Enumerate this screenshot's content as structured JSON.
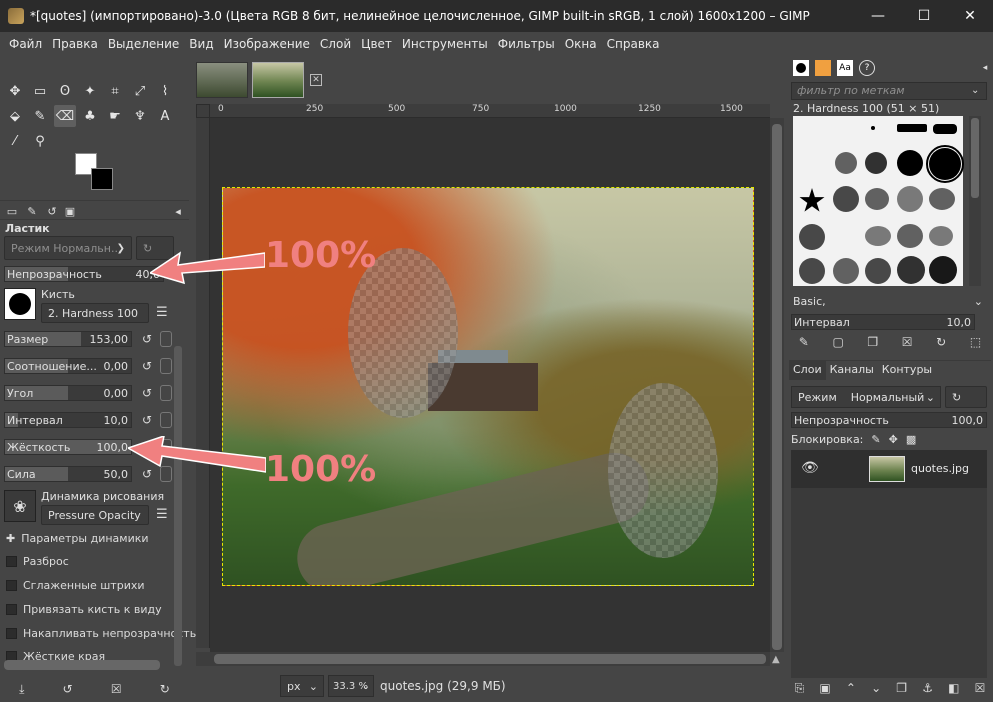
{
  "window": {
    "title": "*[quotes] (импортировано)-3.0 (Цвета RGB 8 бит, нелинейное целочисленное, GIMP built-in sRGB, 1 слой) 1600x1200 – GIMP",
    "minimize": "—",
    "maximize": "☐",
    "close": "✕"
  },
  "menu": [
    "Файл",
    "Правка",
    "Выделение",
    "Вид",
    "Изображение",
    "Слой",
    "Цвет",
    "Инструменты",
    "Фильтры",
    "Окна",
    "Справка"
  ],
  "tool_options": {
    "title": "Ластик",
    "mode_combo": "Режим Нормальн...",
    "opacity": {
      "label": "Непрозрачность",
      "value": "40,0",
      "fraction": 0.4
    },
    "brush_label": "Кисть",
    "brush_name": "2. Hardness 100",
    "size": {
      "label": "Размер",
      "value": "153,00",
      "fraction": 0.6
    },
    "ratio": {
      "label": "Соотношение...",
      "value": "0,00",
      "fraction": 0.5
    },
    "angle": {
      "label": "Угол",
      "value": "0,00",
      "fraction": 0.5
    },
    "spacing": {
      "label": "Интервал",
      "value": "10,0",
      "fraction": 0.1
    },
    "hardness": {
      "label": "Жёсткость",
      "value": "100,0",
      "fraction": 1.0
    },
    "force": {
      "label": "Сила",
      "value": "50,0",
      "fraction": 0.5
    },
    "dynamics_label": "Динамика рисования",
    "dynamics_name": "Pressure Opacity",
    "checks": [
      {
        "label": "Параметры динамики"
      },
      {
        "label": "Разброс"
      },
      {
        "label": "Сглаженные штрихи"
      },
      {
        "label": "Привязать кисть к виду"
      },
      {
        "label": "Накапливать непрозрачность"
      },
      {
        "label": "Жёсткие края"
      }
    ]
  },
  "annotations": {
    "top": "100%",
    "bottom": "100%"
  },
  "rulers": [
    "0",
    "250",
    "500",
    "750",
    "1000",
    "1250",
    "1500"
  ],
  "status": {
    "unit": "px",
    "zoom": "33.3 %",
    "file": "quotes.jpg (29,9 МБ)"
  },
  "brushes": {
    "filter_placeholder": "фильтр по меткам",
    "selected": "2. Hardness 100 (51 × 51)",
    "set": "Basic,",
    "spacing": {
      "label": "Интервал",
      "value": "10,0"
    }
  },
  "layers": {
    "tabs": [
      "Слои",
      "Каналы",
      "Контуры"
    ],
    "mode_label": "Режим",
    "mode_value": "Нормальный",
    "opacity": {
      "label": "Непрозрачность",
      "value": "100,0"
    },
    "lock_label": "Блокировка:",
    "items": [
      {
        "name": "quotes.jpg"
      }
    ]
  }
}
